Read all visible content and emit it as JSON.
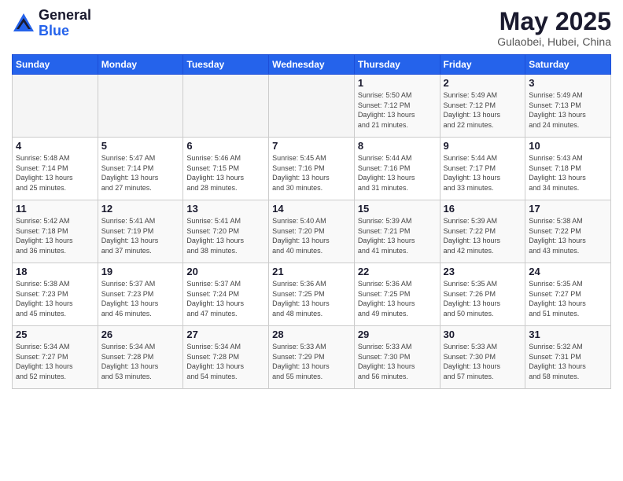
{
  "header": {
    "logo_general": "General",
    "logo_blue": "Blue",
    "month_title": "May 2025",
    "subtitle": "Gulaobei, Hubei, China"
  },
  "days_of_week": [
    "Sunday",
    "Monday",
    "Tuesday",
    "Wednesday",
    "Thursday",
    "Friday",
    "Saturday"
  ],
  "weeks": [
    [
      {
        "day": "",
        "info": ""
      },
      {
        "day": "",
        "info": ""
      },
      {
        "day": "",
        "info": ""
      },
      {
        "day": "",
        "info": ""
      },
      {
        "day": "1",
        "info": "Sunrise: 5:50 AM\nSunset: 7:12 PM\nDaylight: 13 hours\nand 21 minutes."
      },
      {
        "day": "2",
        "info": "Sunrise: 5:49 AM\nSunset: 7:12 PM\nDaylight: 13 hours\nand 22 minutes."
      },
      {
        "day": "3",
        "info": "Sunrise: 5:49 AM\nSunset: 7:13 PM\nDaylight: 13 hours\nand 24 minutes."
      }
    ],
    [
      {
        "day": "4",
        "info": "Sunrise: 5:48 AM\nSunset: 7:14 PM\nDaylight: 13 hours\nand 25 minutes."
      },
      {
        "day": "5",
        "info": "Sunrise: 5:47 AM\nSunset: 7:14 PM\nDaylight: 13 hours\nand 27 minutes."
      },
      {
        "day": "6",
        "info": "Sunrise: 5:46 AM\nSunset: 7:15 PM\nDaylight: 13 hours\nand 28 minutes."
      },
      {
        "day": "7",
        "info": "Sunrise: 5:45 AM\nSunset: 7:16 PM\nDaylight: 13 hours\nand 30 minutes."
      },
      {
        "day": "8",
        "info": "Sunrise: 5:44 AM\nSunset: 7:16 PM\nDaylight: 13 hours\nand 31 minutes."
      },
      {
        "day": "9",
        "info": "Sunrise: 5:44 AM\nSunset: 7:17 PM\nDaylight: 13 hours\nand 33 minutes."
      },
      {
        "day": "10",
        "info": "Sunrise: 5:43 AM\nSunset: 7:18 PM\nDaylight: 13 hours\nand 34 minutes."
      }
    ],
    [
      {
        "day": "11",
        "info": "Sunrise: 5:42 AM\nSunset: 7:18 PM\nDaylight: 13 hours\nand 36 minutes."
      },
      {
        "day": "12",
        "info": "Sunrise: 5:41 AM\nSunset: 7:19 PM\nDaylight: 13 hours\nand 37 minutes."
      },
      {
        "day": "13",
        "info": "Sunrise: 5:41 AM\nSunset: 7:20 PM\nDaylight: 13 hours\nand 38 minutes."
      },
      {
        "day": "14",
        "info": "Sunrise: 5:40 AM\nSunset: 7:20 PM\nDaylight: 13 hours\nand 40 minutes."
      },
      {
        "day": "15",
        "info": "Sunrise: 5:39 AM\nSunset: 7:21 PM\nDaylight: 13 hours\nand 41 minutes."
      },
      {
        "day": "16",
        "info": "Sunrise: 5:39 AM\nSunset: 7:22 PM\nDaylight: 13 hours\nand 42 minutes."
      },
      {
        "day": "17",
        "info": "Sunrise: 5:38 AM\nSunset: 7:22 PM\nDaylight: 13 hours\nand 43 minutes."
      }
    ],
    [
      {
        "day": "18",
        "info": "Sunrise: 5:38 AM\nSunset: 7:23 PM\nDaylight: 13 hours\nand 45 minutes."
      },
      {
        "day": "19",
        "info": "Sunrise: 5:37 AM\nSunset: 7:23 PM\nDaylight: 13 hours\nand 46 minutes."
      },
      {
        "day": "20",
        "info": "Sunrise: 5:37 AM\nSunset: 7:24 PM\nDaylight: 13 hours\nand 47 minutes."
      },
      {
        "day": "21",
        "info": "Sunrise: 5:36 AM\nSunset: 7:25 PM\nDaylight: 13 hours\nand 48 minutes."
      },
      {
        "day": "22",
        "info": "Sunrise: 5:36 AM\nSunset: 7:25 PM\nDaylight: 13 hours\nand 49 minutes."
      },
      {
        "day": "23",
        "info": "Sunrise: 5:35 AM\nSunset: 7:26 PM\nDaylight: 13 hours\nand 50 minutes."
      },
      {
        "day": "24",
        "info": "Sunrise: 5:35 AM\nSunset: 7:27 PM\nDaylight: 13 hours\nand 51 minutes."
      }
    ],
    [
      {
        "day": "25",
        "info": "Sunrise: 5:34 AM\nSunset: 7:27 PM\nDaylight: 13 hours\nand 52 minutes."
      },
      {
        "day": "26",
        "info": "Sunrise: 5:34 AM\nSunset: 7:28 PM\nDaylight: 13 hours\nand 53 minutes."
      },
      {
        "day": "27",
        "info": "Sunrise: 5:34 AM\nSunset: 7:28 PM\nDaylight: 13 hours\nand 54 minutes."
      },
      {
        "day": "28",
        "info": "Sunrise: 5:33 AM\nSunset: 7:29 PM\nDaylight: 13 hours\nand 55 minutes."
      },
      {
        "day": "29",
        "info": "Sunrise: 5:33 AM\nSunset: 7:30 PM\nDaylight: 13 hours\nand 56 minutes."
      },
      {
        "day": "30",
        "info": "Sunrise: 5:33 AM\nSunset: 7:30 PM\nDaylight: 13 hours\nand 57 minutes."
      },
      {
        "day": "31",
        "info": "Sunrise: 5:32 AM\nSunset: 7:31 PM\nDaylight: 13 hours\nand 58 minutes."
      }
    ]
  ]
}
